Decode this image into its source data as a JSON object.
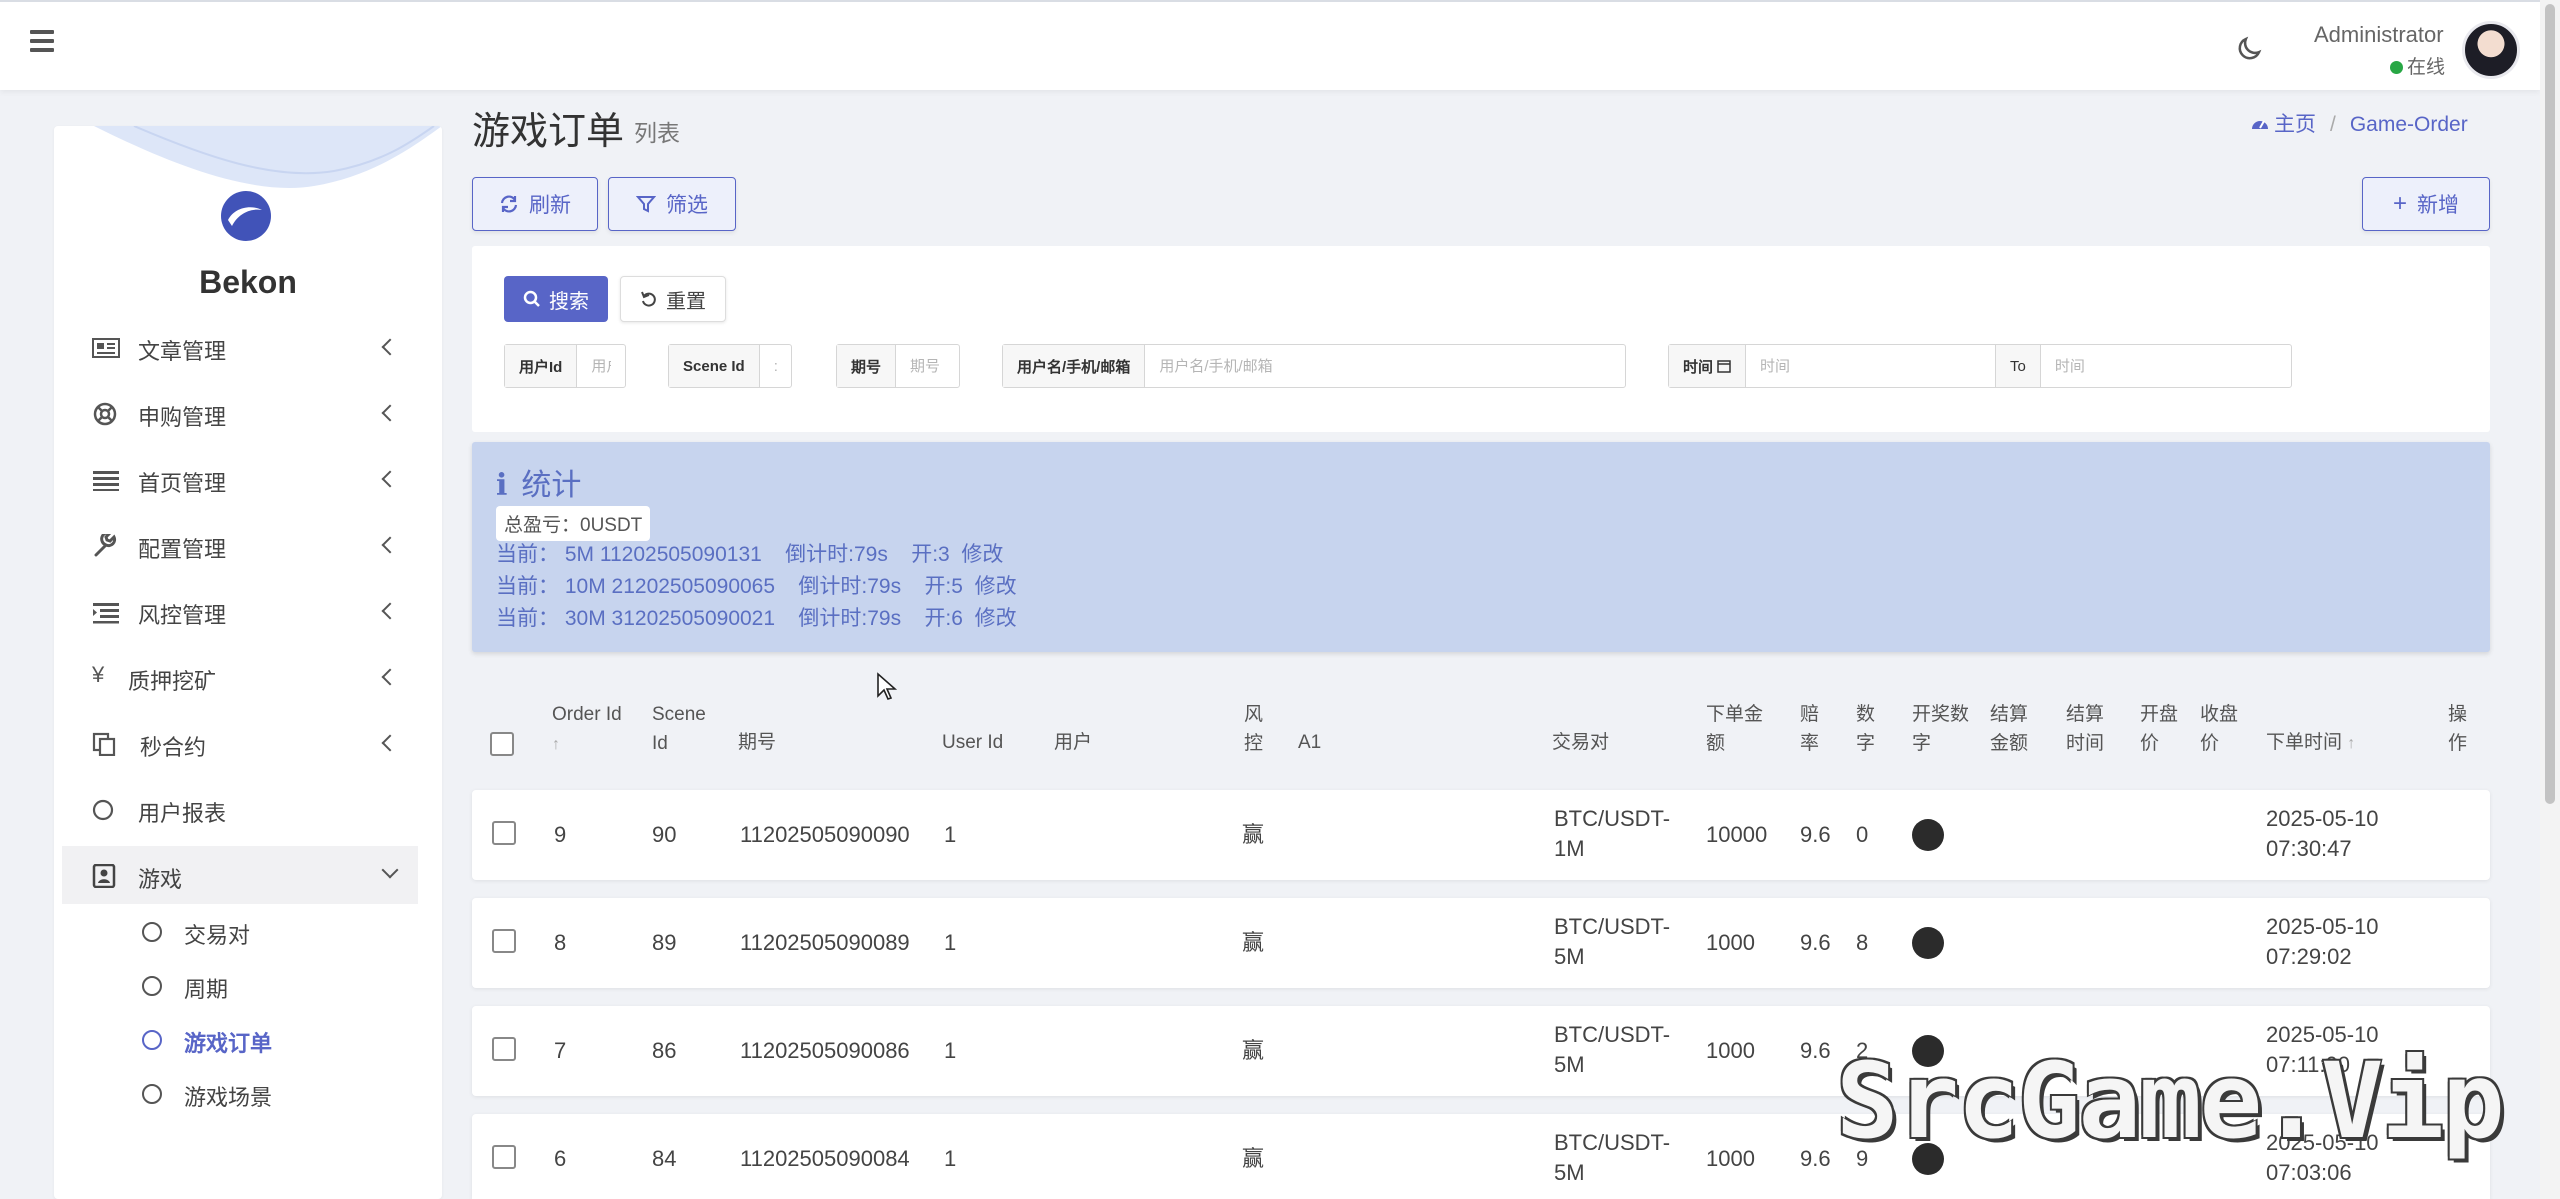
{
  "header": {
    "admin_name": "Administrator",
    "status_text": "在线"
  },
  "sidebar": {
    "brand": "Bekon",
    "items": [
      {
        "label": "文章管理"
      },
      {
        "label": "申购管理"
      },
      {
        "label": "首页管理"
      },
      {
        "label": "配置管理"
      },
      {
        "label": "风控管理"
      },
      {
        "label": "质押挖矿"
      },
      {
        "label": "秒合约"
      },
      {
        "label": "用户报表"
      },
      {
        "label": "游戏"
      }
    ],
    "sub_items": [
      {
        "label": "交易对"
      },
      {
        "label": "周期"
      },
      {
        "label": "游戏订单"
      },
      {
        "label": "游戏场景"
      }
    ]
  },
  "page": {
    "title": "游戏订单",
    "subtitle": "列表",
    "breadcrumb_home": "主页",
    "breadcrumb_current": "Game-Order"
  },
  "toolbar": {
    "refresh_label": "刷新",
    "filter_label": "筛选",
    "add_label": "新增"
  },
  "search": {
    "search_label": "搜索",
    "reset_label": "重置",
    "fields": [
      {
        "label": "用户Id",
        "placeholder": "用户"
      },
      {
        "label": "Scene Id",
        "placeholder": ":"
      },
      {
        "label": "期号",
        "placeholder": "期号"
      },
      {
        "label": "用户名/手机/邮箱",
        "placeholder": "用户名/手机/邮箱"
      },
      {
        "label": "时间",
        "placeholder": "时间"
      },
      {
        "label": "To",
        "placeholder": "时间"
      }
    ]
  },
  "stats": {
    "title": "统计",
    "total": "总盈亏：0USDT",
    "lines": [
      {
        "prefix": "当前：",
        "code": "5M 11202505090131",
        "countdown": "倒计时:79s",
        "open": "开:3",
        "edit": "修改"
      },
      {
        "prefix": "当前：",
        "code": "10M 21202505090065",
        "countdown": "倒计时:79s",
        "open": "开:5",
        "edit": "修改"
      },
      {
        "prefix": "当前：",
        "code": "30M 31202505090021",
        "countdown": "倒计时:79s",
        "open": "开:6",
        "edit": "修改"
      }
    ]
  },
  "table": {
    "headers": {
      "order_id": "Order Id",
      "scene_id": "Scene Id",
      "period": "期号",
      "user_id": "User Id",
      "user": "用户",
      "risk": "风控",
      "a1": "A1",
      "pair": "交易对",
      "amount": "下单金额",
      "odds": "赔率",
      "number": "数字",
      "draw_number": "开奖数字",
      "settle_amount": "结算金额",
      "settle_time": "结算时间",
      "open_price": "开盘价",
      "close_price": "收盘价",
      "order_time": "下单时间",
      "action": "操作"
    },
    "rows": [
      {
        "order_id": "9",
        "scene_id": "90",
        "period": "11202505090090",
        "user_id": "1",
        "risk": "赢",
        "pair": "BTC/USDT-1M",
        "amount": "10000",
        "odds": "9.6",
        "number": "0",
        "time": "2025-05-10 07:30:47"
      },
      {
        "order_id": "8",
        "scene_id": "89",
        "period": "11202505090089",
        "user_id": "1",
        "risk": "赢",
        "pair": "BTC/USDT-5M",
        "amount": "1000",
        "odds": "9.6",
        "number": "8",
        "time": "2025-05-10 07:29:02"
      },
      {
        "order_id": "7",
        "scene_id": "86",
        "period": "11202505090086",
        "user_id": "1",
        "risk": "赢",
        "pair": "BTC/USDT-5M",
        "amount": "1000",
        "odds": "9.6",
        "number": "2",
        "time": "2025-05-10 07:11:00"
      },
      {
        "order_id": "6",
        "scene_id": "84",
        "period": "11202505090084",
        "user_id": "1",
        "risk": "赢",
        "pair": "BTC/USDT-5M",
        "amount": "1000",
        "odds": "9.6",
        "number": "9",
        "time": "2025-05-10 07:03:06"
      }
    ]
  },
  "watermark": "SrcGame.Vip",
  "colors": {
    "accent": "#5865c7",
    "stats_bg": "#c7d4ee",
    "page_bg": "#f0f2f6"
  }
}
